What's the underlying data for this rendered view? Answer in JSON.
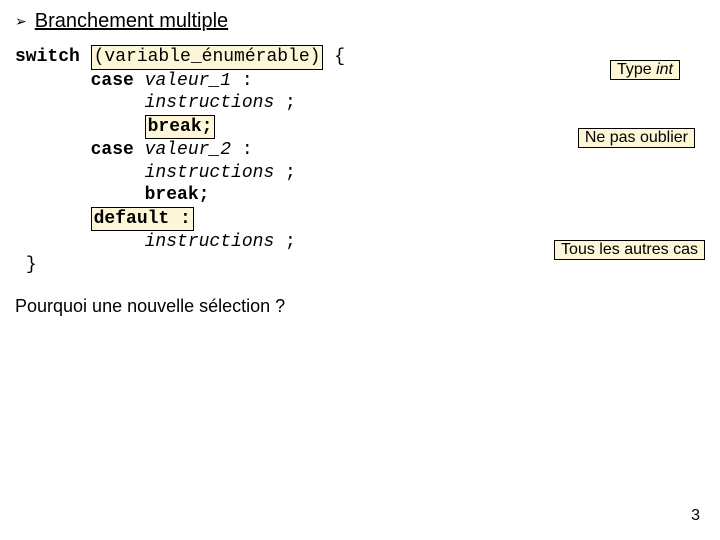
{
  "heading": {
    "bullet": "➢",
    "title": "Branchement multiple"
  },
  "code": {
    "switch_kw": "switch",
    "switch_expr": "(variable_énumérable)",
    "open_brace": " {",
    "case_kw": "case",
    "case1_val": "valeur_1",
    "colon": " :",
    "instr": "instructions",
    "semi": " ;",
    "break_stmt": "break;",
    "case2_val": "valeur_2",
    "default_kw": "default :",
    "close_brace": "}"
  },
  "annot": {
    "type_label": "Type ",
    "type_val": "int",
    "dont_forget": "Ne pas oublier",
    "other_cases": "Tous les autres cas"
  },
  "question": "Pourquoi une nouvelle sélection ?",
  "pagenum": "3"
}
